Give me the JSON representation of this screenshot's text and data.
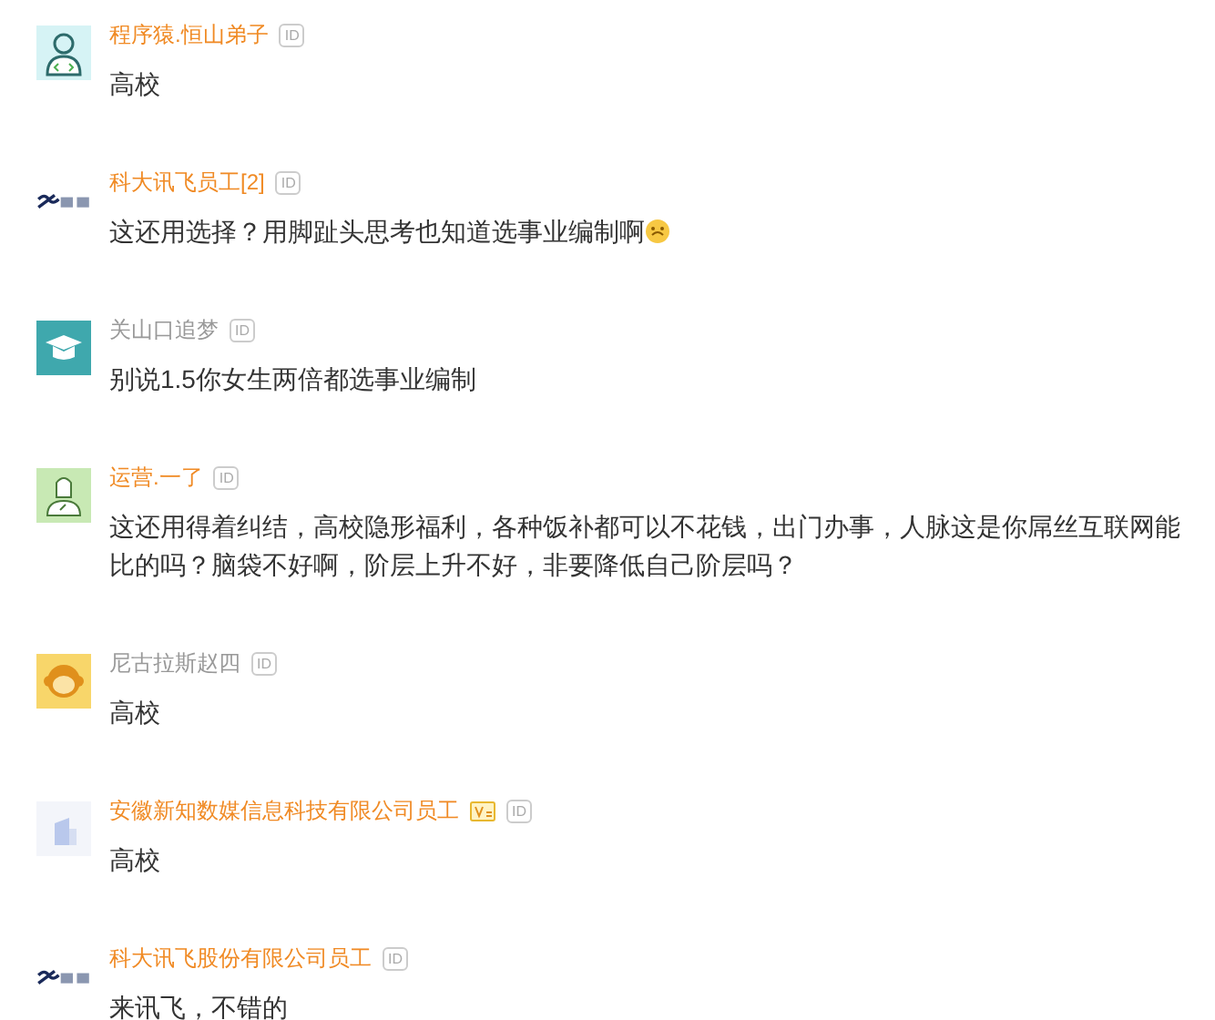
{
  "comments": [
    {
      "avatar": {
        "kind": "coder"
      },
      "name": "程序猿.恒山弟子",
      "highlighted": true,
      "id_tag": "ID",
      "text": "高校"
    },
    {
      "avatar": {
        "kind": "brand-logo"
      },
      "name": "科大讯飞员工[2]",
      "highlighted": true,
      "id_tag": "ID",
      "text": "这还用选择？用脚趾头思考也知道选事业编制啊",
      "emoji": true
    },
    {
      "avatar": {
        "kind": "graduation-cap"
      },
      "name": "关山口追梦",
      "highlighted": false,
      "id_tag": "ID",
      "text": "别说1.5你女生两倍都选事业编制"
    },
    {
      "avatar": {
        "kind": "figure"
      },
      "name": "运营.一了",
      "highlighted": true,
      "id_tag": "ID",
      "text": "这还用得着纠结，高校隐形福利，各种饭补都可以不花钱，出门办事，人脉这是你屌丝互联网能比的吗？脑袋不好啊，阶层上升不好，非要降低自己阶层吗？"
    },
    {
      "avatar": {
        "kind": "monkey"
      },
      "name": "尼古拉斯赵四",
      "highlighted": false,
      "id_tag": "ID",
      "text": "高校"
    },
    {
      "avatar": {
        "kind": "building"
      },
      "name": "安徽新知数媒信息科技有限公司员工",
      "highlighted": true,
      "badge": true,
      "id_tag": "ID",
      "text": "高校"
    },
    {
      "avatar": {
        "kind": "brand-logo"
      },
      "name": "科大讯飞股份有限公司员工",
      "highlighted": true,
      "id_tag": "ID",
      "text": "来讯飞，不错的"
    }
  ]
}
